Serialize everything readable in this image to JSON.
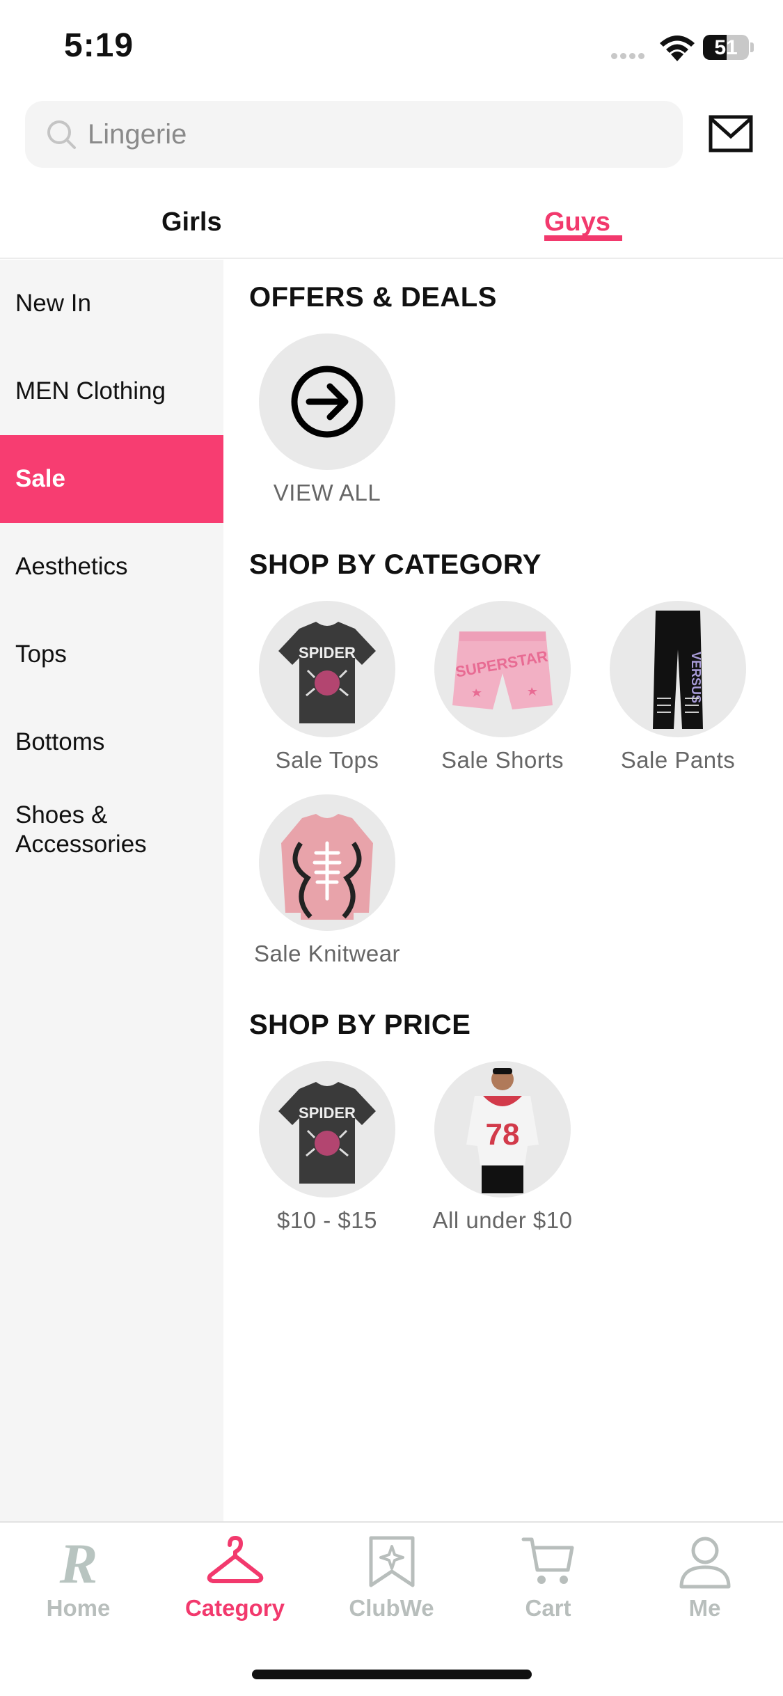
{
  "status_bar": {
    "time": "5:19",
    "battery": "51",
    "battery_level": 0.51
  },
  "search": {
    "placeholder": "Lingerie"
  },
  "gender_tabs": [
    {
      "label": "Girls",
      "active": false
    },
    {
      "label": "Guys",
      "active": true
    }
  ],
  "sidebar": {
    "items": [
      {
        "label": "New In"
      },
      {
        "label": "MEN Clothing"
      },
      {
        "label": "Sale",
        "active": true
      },
      {
        "label": "Aesthetics"
      },
      {
        "label": "Tops"
      },
      {
        "label": "Bottoms"
      },
      {
        "label": "Shoes & Accessories"
      }
    ]
  },
  "sections": {
    "offers": {
      "title": "OFFERS & DEALS",
      "items": [
        {
          "label": "VIEW ALL",
          "icon": "arrow-right-circle-icon"
        }
      ]
    },
    "category": {
      "title": "SHOP BY CATEGORY",
      "items": [
        {
          "label": "Sale Tops"
        },
        {
          "label": "Sale Shorts"
        },
        {
          "label": "Sale Pants"
        },
        {
          "label": "Sale Knitwear"
        }
      ]
    },
    "price": {
      "title": "SHOP BY PRICE",
      "items": [
        {
          "label": "$10 - $15"
        },
        {
          "label": "All under $10"
        }
      ]
    }
  },
  "bottom_nav": [
    {
      "label": "Home",
      "icon": "home-r-logo-icon"
    },
    {
      "label": "Category",
      "icon": "hanger-icon",
      "active": true
    },
    {
      "label": "ClubWe",
      "icon": "star-badge-icon"
    },
    {
      "label": "Cart",
      "icon": "cart-icon"
    },
    {
      "label": "Me",
      "icon": "person-icon"
    }
  ],
  "colors": {
    "accent": "#f2396d",
    "sidebar_active": "#f73d71",
    "sidebar_bg": "#f5f5f5",
    "nav_inactive": "#b8bebc"
  }
}
